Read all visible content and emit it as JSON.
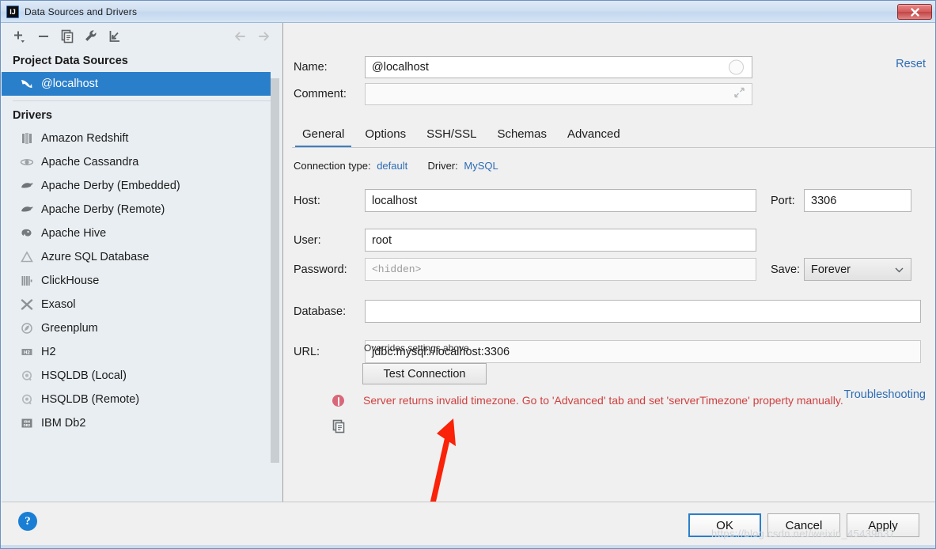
{
  "window": {
    "title": "Data Sources and Drivers",
    "app_icon": "intellij-idea-icon",
    "close_label": "✕"
  },
  "toolbar": {
    "icons": [
      {
        "name": "add-icon",
        "tooltip": "Add"
      },
      {
        "name": "remove-icon",
        "tooltip": "Remove"
      },
      {
        "name": "copy-icon",
        "tooltip": "Duplicate"
      },
      {
        "name": "wrench-icon",
        "tooltip": "Properties"
      },
      {
        "name": "import-icon",
        "tooltip": "Import"
      },
      {
        "name": "arrow-left-icon",
        "tooltip": "Back"
      },
      {
        "name": "arrow-right-icon",
        "tooltip": "Forward"
      }
    ]
  },
  "sidebar": {
    "project_sources_header": "Project Data Sources",
    "data_sources": [
      {
        "label": "@localhost",
        "icon": "mysql-dolphin-icon",
        "selected": true
      }
    ],
    "drivers_header": "Drivers",
    "drivers": [
      {
        "label": "Amazon Redshift",
        "icon": "redshift-icon"
      },
      {
        "label": "Apache Cassandra",
        "icon": "cassandra-eye-icon"
      },
      {
        "label": "Apache Derby (Embedded)",
        "icon": "derby-icon"
      },
      {
        "label": "Apache Derby (Remote)",
        "icon": "derby-icon"
      },
      {
        "label": "Apache Hive",
        "icon": "hive-elephant-icon"
      },
      {
        "label": "Azure SQL Database",
        "icon": "azure-icon"
      },
      {
        "label": "ClickHouse",
        "icon": "clickhouse-icon"
      },
      {
        "label": "Exasol",
        "icon": "exasol-icon"
      },
      {
        "label": "Greenplum",
        "icon": "greenplum-icon"
      },
      {
        "label": "H2",
        "icon": "h2-icon"
      },
      {
        "label": "HSQLDB (Local)",
        "icon": "hsqldb-icon"
      },
      {
        "label": "HSQLDB (Remote)",
        "icon": "hsqldb-icon"
      },
      {
        "label": "IBM Db2",
        "icon": "ibm-db2-icon"
      }
    ]
  },
  "details": {
    "name_label": "Name:",
    "name_value": "@localhost",
    "comment_label": "Comment:",
    "comment_value": "",
    "reset_label": "Reset",
    "tabs": [
      {
        "label": "General",
        "active": true
      },
      {
        "label": "Options",
        "active": false
      },
      {
        "label": "SSH/SSL",
        "active": false
      },
      {
        "label": "Schemas",
        "active": false
      },
      {
        "label": "Advanced",
        "active": false
      }
    ],
    "connection_type_label": "Connection type:",
    "connection_type_value": "default",
    "driver_label": "Driver:",
    "driver_value": "MySQL",
    "host_label": "Host:",
    "host_value": "localhost",
    "port_label": "Port:",
    "port_value": "3306",
    "user_label": "User:",
    "user_value": "root",
    "password_label": "Password:",
    "password_placeholder": "<hidden>",
    "save_label": "Save:",
    "save_value": "Forever",
    "database_label": "Database:",
    "database_value": "",
    "url_label": "URL:",
    "url_value": "jdbc:mysql://localhost:3306",
    "url_hint": "Overrides settings above",
    "test_connection_label": "Test Connection",
    "troubleshooting_label": "Troubleshooting",
    "error_message": "Server returns invalid timezone. Go to 'Advanced' tab and set 'serverTimezone' property manually."
  },
  "footer": {
    "help_label": "?",
    "ok_label": "OK",
    "cancel_label": "Cancel",
    "apply_label": "Apply"
  },
  "watermark": {
    "text": "https://blog.csdn.net/weixin_45439637"
  },
  "colors": {
    "selection_blue": "#2a7fca",
    "link_blue": "#2d6cb5",
    "error_red": "#cf4040",
    "annotation_red": "#fa2208",
    "panel_bg": "#f0f0f0",
    "sidebar_bg": "#e9eef2"
  }
}
